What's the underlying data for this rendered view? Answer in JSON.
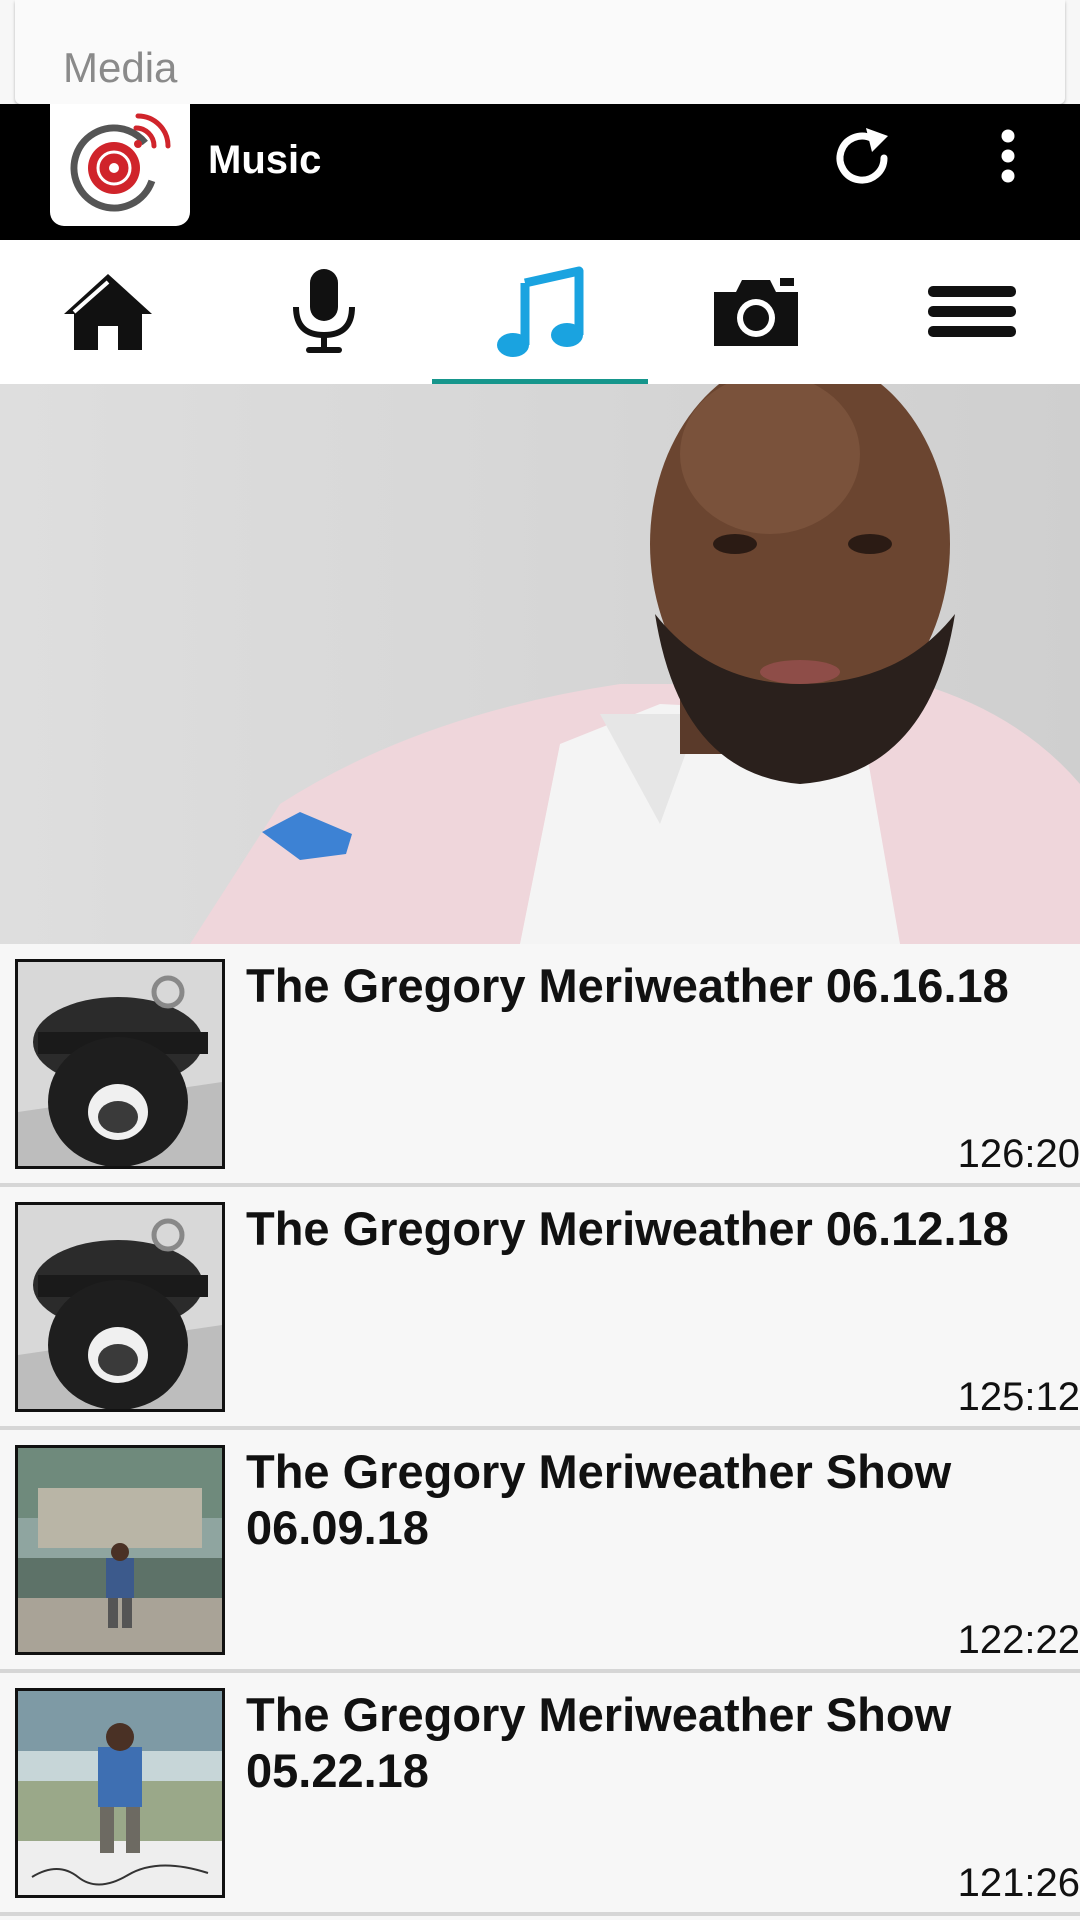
{
  "search": {
    "label": "Media"
  },
  "appbar": {
    "title": "Music",
    "logo_icon": "radio-broadcast-logo",
    "refresh_icon": "refresh-icon",
    "overflow_icon": "more-vert-icon"
  },
  "tabs": [
    {
      "name": "home",
      "icon": "home-icon",
      "active": false
    },
    {
      "name": "podcast",
      "icon": "microphone-icon",
      "active": false
    },
    {
      "name": "music",
      "icon": "music-note-icon",
      "active": true
    },
    {
      "name": "photos",
      "icon": "camera-icon",
      "active": false
    },
    {
      "name": "menu",
      "icon": "hamburger-menu-icon",
      "active": false
    }
  ],
  "colors": {
    "accent_icon": "#1aa3e0",
    "tab_indicator": "#16968c",
    "appbar_bg": "#000000",
    "logo_red": "#d0242b"
  },
  "episodes": [
    {
      "title": "The Gregory Meriweather 06.16.18",
      "duration": "126:20",
      "thumb": "bw-headphones-portrait"
    },
    {
      "title": "The Gregory Meriweather 06.12.18",
      "duration": "125:12",
      "thumb": "bw-headphones-portrait"
    },
    {
      "title": "The Gregory Meriweather Show 06.09.18",
      "duration": "122:22",
      "thumb": "beverly-hills-sign-photo"
    },
    {
      "title": "The Gregory Meriweather Show 05.22.18",
      "duration": "121:26",
      "thumb": "seated-portrait-signature"
    }
  ]
}
